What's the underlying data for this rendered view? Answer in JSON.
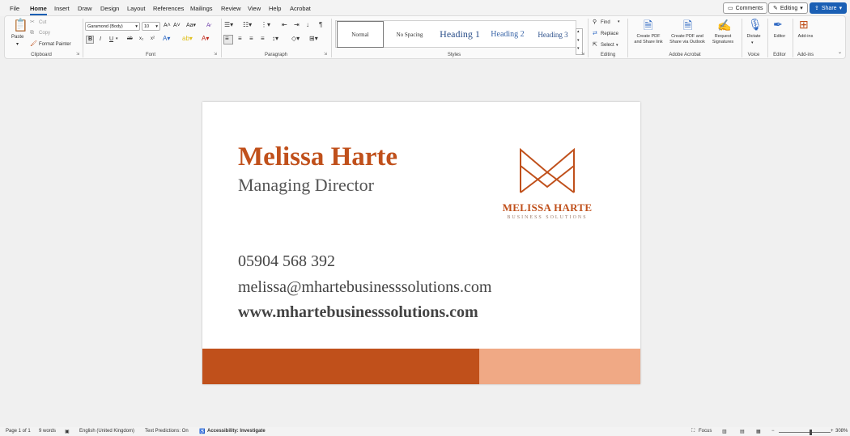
{
  "menu": {
    "tabs": [
      "File",
      "Home",
      "Insert",
      "Draw",
      "Design",
      "Layout",
      "References",
      "Mailings",
      "Review",
      "View",
      "Help",
      "Acrobat"
    ],
    "active_tab": "Home",
    "comments_label": "Comments",
    "editing_label": "Editing",
    "share_label": "Share"
  },
  "ribbon": {
    "clipboard": {
      "paste": "Paste",
      "cut": "Cut",
      "copy": "Copy",
      "format_painter": "Format Painter",
      "label": "Clipboard"
    },
    "font": {
      "font_name": "Garamond (Body)",
      "font_size": "10",
      "label": "Font"
    },
    "paragraph": {
      "label": "Paragraph"
    },
    "styles": {
      "items": [
        "Normal",
        "No Spacing",
        "Heading 1",
        "Heading 2",
        "Heading 3"
      ],
      "selected": "Normal",
      "label": "Styles"
    },
    "editing": {
      "find": "Find",
      "replace": "Replace",
      "select": "Select",
      "label": "Editing"
    },
    "acrobat": {
      "create_pdf": "Create PDF",
      "create_pdf_2": "and Share link",
      "share_outlook": "Create PDF and",
      "share_outlook_2": "Share via Outlook",
      "request": "Request",
      "request_2": "Signatures",
      "label": "Adobe Acrobat"
    },
    "voice": {
      "dictate": "Dictate",
      "label": "Voice"
    },
    "editor": {
      "editor": "Editor",
      "label": "Editor"
    },
    "addins": {
      "addins": "Add-ins",
      "label": "Add-ins"
    }
  },
  "document": {
    "name": "Melissa Harte",
    "role": "Managing Director",
    "phone": "05904 568 392",
    "email": "melissa@mhartebusinesssolutions.com",
    "website": "www.mhartebusinesssolutions.com",
    "logo_name": "MELISSA HARTE",
    "logo_sub": "BUSINESS SOLUTIONS",
    "colors": {
      "accent": "#c0501b",
      "accent_light": "#f0a985"
    }
  },
  "status": {
    "page": "Page 1 of 1",
    "words": "9 words",
    "language": "English (United Kingdom)",
    "predictions": "Text Predictions: On",
    "accessibility": "Accessibility: Investigate",
    "focus": "Focus",
    "zoom": "308%"
  }
}
